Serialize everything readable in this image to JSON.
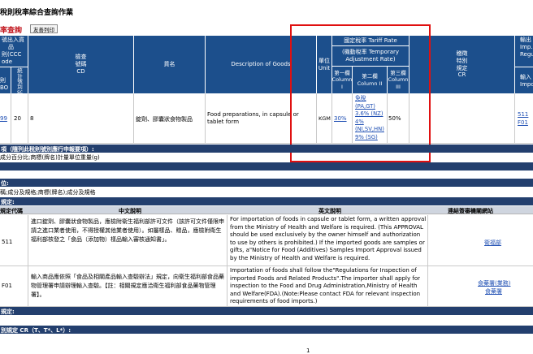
{
  "page": {
    "title": "稅則稅率綜合查詢作業"
  },
  "toolbar": {
    "section_label": "率查詢",
    "print_button": "友善列印"
  },
  "main_header": {
    "col_a_lines": [
      "號出入貨",
      "品",
      "則(CCC",
      "ode"
    ],
    "col_a_sub": [
      "則",
      "BO"
    ],
    "col_b_sub": [
      "統",
      "計",
      "號",
      "別",
      "sc"
    ],
    "check_code": "檢查\n號碼\nCD",
    "goods_name": "貨名",
    "description": "Description of Goods",
    "unit": "單位\nUnit",
    "tariff_title": "國定稅率 Tariff Rate",
    "tariff_sub": "(機動稅率 Temporary\nAdjustment Rate)",
    "col1": "第一欄\nColumn\nI",
    "col2": "第二欄\nColumn II",
    "col3": "第三欄\nColumn\nIII",
    "special": "稽徵\n特別\n規定\nCR",
    "right_cut1": [
      "輸出",
      "Imp.",
      "Regu"
    ],
    "right_cut2": [
      "輸入",
      "Impo"
    ]
  },
  "data_row": {
    "code_a": "99",
    "code_b": "20",
    "check": "8",
    "goods_name": "錠劑、膠囊狀食物製品",
    "description": "Food preparations, in capsule or tablet form",
    "unit": "KGM",
    "col1": "30%",
    "col2_lines": [
      "免稅",
      "(PA,GT)",
      "3.6% (NZ)",
      "4%",
      "(NI,SV,HN)",
      "9% (SG)"
    ],
    "col3": "50%",
    "import_regs": [
      "511",
      "F01"
    ]
  },
  "sections": {
    "s1": "項（隨列此稅則號別應行申報要項）:",
    "s1_text": "成分百分比;商標(牌名)計量單位重量(g)",
    "s2": "位:",
    "s2_text": "稱;成分及規格;商標(牌名);成分及規格",
    "s3": "規定:",
    "s4": "規定:",
    "s5": "別規定 CR（T、T*、L*）:"
  },
  "reg_table": {
    "headers": [
      "規定代碼",
      "中文說明",
      "英文說明",
      "連結簽審機關網站"
    ],
    "rows": [
      {
        "code": "511",
        "zh": "進口錠劑、膠囊狀食物製品，應檢附衛生福利部許可文件（該許可文件僅限申請之進口業者使用，不得授權其他業者使用）。如屬樣品、贈品，應檢附衛生福利部核發之「食品（添加物）樣品輸入審核通知書」。",
        "en": "For importation of foods in capsule or tablet form, a written approval from the Ministry of Health and Welfare is required. (This APPROVAL should be used exclusively by the owner himself and authorization to use by others is prohibited.) If the imported goods are samples or gifts, a\"Notice for Food (Additives) Samples Import Approval issued by the Ministry of Health and Welfare is required.",
        "links": [
          "衛福部"
        ]
      },
      {
        "code": "F01",
        "zh": "輸入商品應依照「食品及相關產品輸入查驗辦法」規定，向衛生福利部食品藥物管理署申請辦理輸入查驗。【註：相關規定應洽衛生福利部食品藥物管理署】。",
        "en": "Importation of foods shall follow the\"Regulations for Inspection of imported Foods and Related Products\".The importer shall apply for inspection to the Food and Drug Administration,Ministry of Health and Welfare(FDA).(Note:Please contact FDA for relevant inspection requirements of food imports.)",
        "links": [
          "食藥署(業務)",
          "食藥署"
        ]
      }
    ]
  },
  "footer": {
    "page_number": "1"
  },
  "colors": {
    "header_blue": "#1c4f8c",
    "section_navy": "#233f6e",
    "highlight": "#e01010",
    "link": "#1f4fb3"
  }
}
